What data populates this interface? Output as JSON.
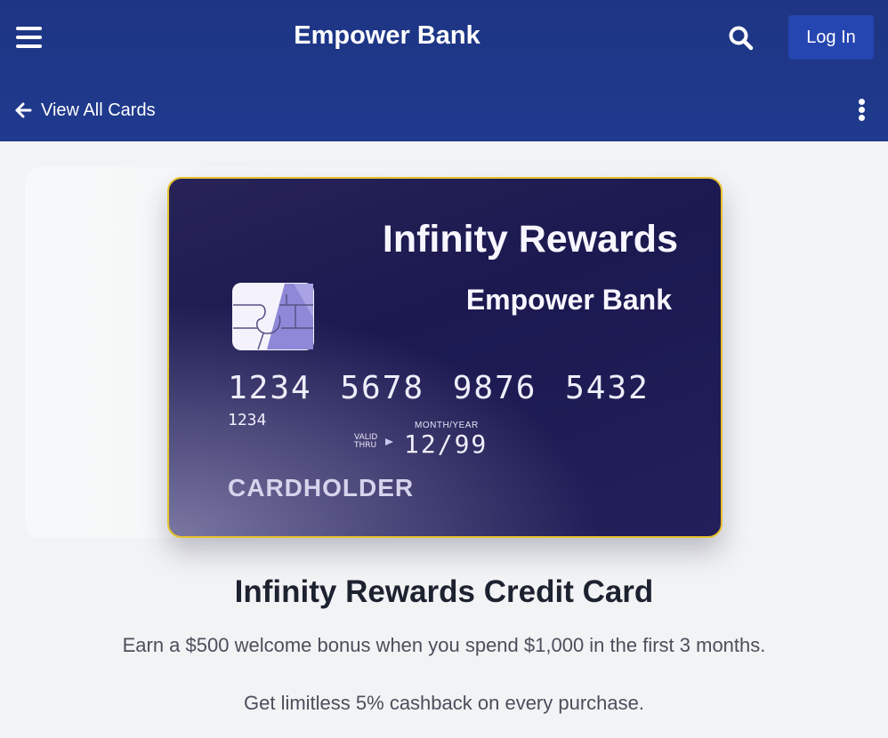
{
  "header": {
    "brand": "Empower Bank",
    "login_label": "Log In",
    "back_label": "View All Cards"
  },
  "card": {
    "title": "Infinity Rewards",
    "bank": "Empower Bank",
    "number": "1234 5678 9876 5432",
    "number_sub": "1234",
    "valid_thru": "VALID THRU",
    "month_year_label": "MONTH/YEAR",
    "expiry": "12/99",
    "cardholder": "CARDHOLDER"
  },
  "product": {
    "title": "Infinity Rewards Credit Card",
    "offer_1": "Earn a $500 welcome bonus when you spend $1,000 in the first 3 months.",
    "offer_2": "Get limitless 5% cashback on every purchase."
  },
  "icons": {
    "menu": "hamburger-menu-icon",
    "search": "search-icon",
    "back": "arrow-left-icon",
    "more": "more-vertical-icon",
    "chip": "card-chip-icon"
  },
  "colors": {
    "header_bg": "#1f3a8e",
    "login_bg": "#2545b0",
    "card_bg": "#1b1950",
    "card_border": "#e7c22f",
    "page_bg": "#f2f3f5"
  }
}
